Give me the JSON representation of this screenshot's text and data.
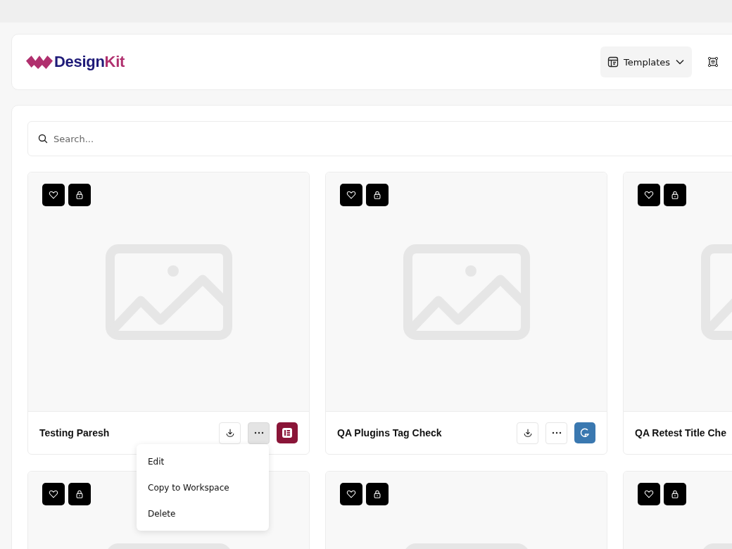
{
  "header": {
    "logo": {
      "part_1": "Design",
      "part_2": "Kit"
    },
    "nav": [
      {
        "label": "Templates",
        "kind": "template",
        "dropdown": true
      },
      {
        "kind": "workspace",
        "dropdown": false
      }
    ]
  },
  "search": {
    "placeholder": "Search..."
  },
  "cards": [
    {
      "thumbnail": {
        "kind": "placeholder"
      },
      "title": "Testing Paresh",
      "badge": {
        "kind": "elementor"
      },
      "menu_open": true
    },
    {
      "thumbnail": {
        "kind": "placeholder"
      },
      "title": "QA Plugins Tag Check",
      "badge": {
        "kind": "gutenberg"
      },
      "menu_open": false
    },
    {
      "thumbnail": {
        "kind": "placeholder"
      },
      "title": "QA Retest Title Che"
    },
    {
      "thumbnail": {
        "kind": "placeholder"
      }
    },
    {
      "thumbnail": {
        "kind": "placeholder"
      }
    },
    {
      "thumbnail": {
        "kind": "placeholder"
      }
    }
  ],
  "card_menu": {
    "items": [
      {
        "label": "Edit"
      },
      {
        "label": "Copy to Workspace"
      },
      {
        "label": "Delete"
      }
    ]
  }
}
